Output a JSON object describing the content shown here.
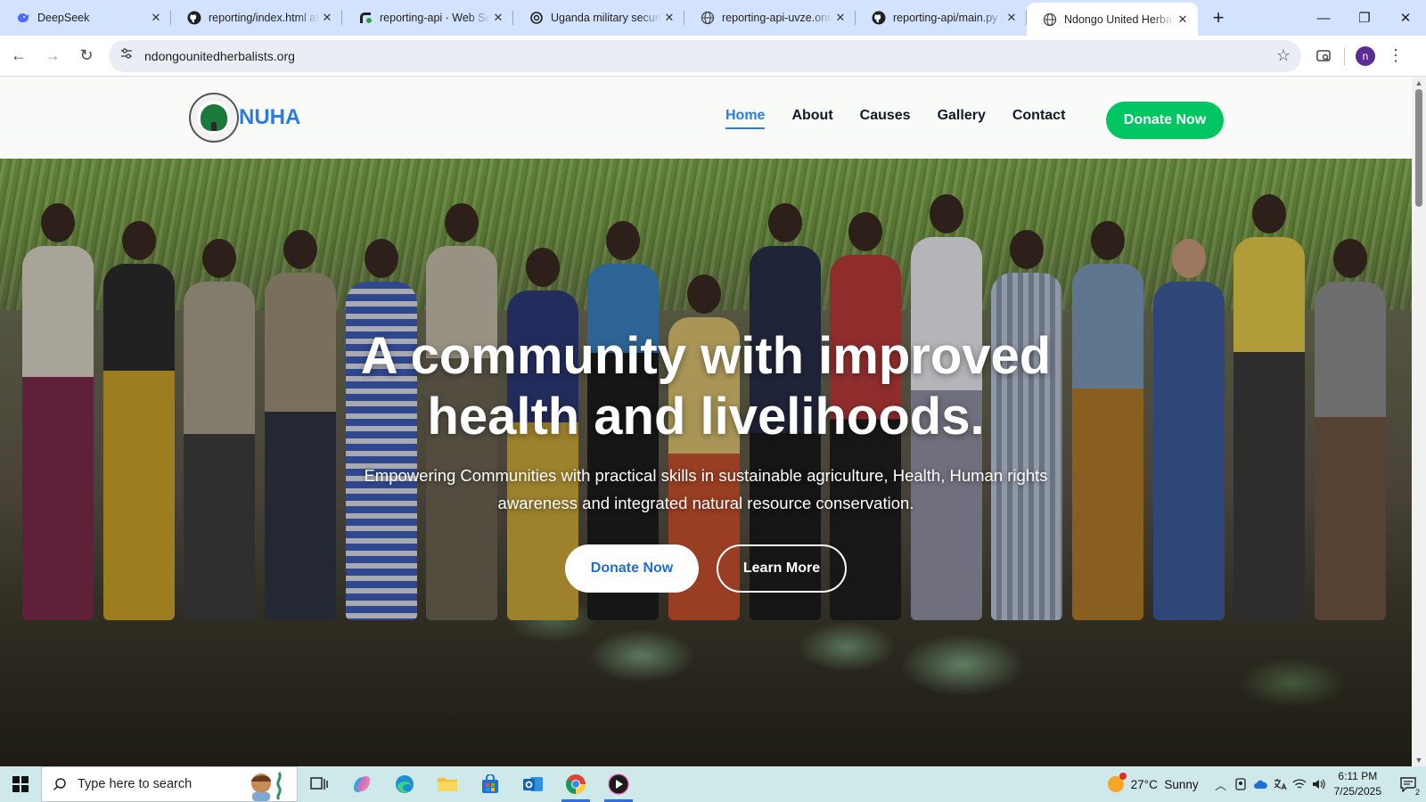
{
  "browser": {
    "tabs": [
      {
        "title": "DeepSeek",
        "icon": "deepseek-icon",
        "active": false
      },
      {
        "title": "reporting/index.html at",
        "icon": "github-icon",
        "active": false
      },
      {
        "title": "reporting-api · Web Se",
        "icon": "render-icon",
        "active": false
      },
      {
        "title": "Uganda military securit",
        "icon": "chatgpt-icon",
        "active": false
      },
      {
        "title": "reporting-api-uvze.onre",
        "icon": "globe-icon",
        "active": false
      },
      {
        "title": "reporting-api/main.py a",
        "icon": "github-icon",
        "active": false
      },
      {
        "title": "Ndongo United Herbali",
        "icon": "globe-icon",
        "active": true
      }
    ],
    "url": "ndongounitedherbalists.org",
    "profile_initial": "n"
  },
  "site": {
    "brand": "NUHA",
    "nav": [
      "Home",
      "About",
      "Causes",
      "Gallery",
      "Contact"
    ],
    "active_nav": "Home",
    "donate_label": "Donate Now",
    "hero": {
      "title_line1": "A community with improved",
      "title_line2": "health and livelihoods.",
      "subtitle": "Empowering Communities with practical skills in sustainable agriculture, Health, Human rights awareness and integrated natural resource conservation.",
      "primary_button": "Donate Now",
      "secondary_button": "Learn More"
    }
  },
  "taskbar": {
    "search_placeholder": "Type here to search",
    "weather": "27°C  Sunny",
    "time": "6:11 PM",
    "date": "7/25/2025",
    "notification_count": "2"
  },
  "colors": {
    "accent_blue": "#2b7be0",
    "donate_green": "#00c563",
    "tabstrip": "#d3e3fd",
    "taskbar": "#cfe8ea"
  }
}
